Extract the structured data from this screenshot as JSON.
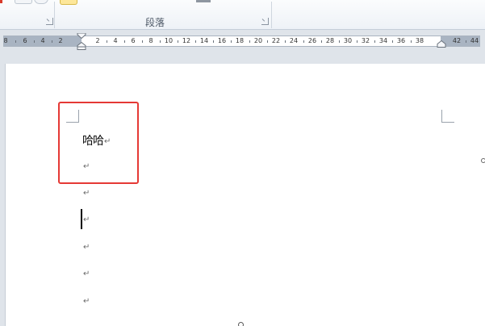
{
  "ribbon": {
    "group_label": "段落"
  },
  "ruler": {
    "labels": [
      "8",
      "6",
      "4",
      "2",
      "2",
      "4",
      "6",
      "8",
      "10",
      "12",
      "14",
      "16",
      "18",
      "20",
      "22",
      "24",
      "26",
      "28",
      "30",
      "32",
      "34",
      "36",
      "38",
      "42",
      "44"
    ]
  },
  "document": {
    "lines": [
      "哈哈",
      "",
      "",
      "",
      "",
      "",
      ""
    ],
    "paragraph_mark": "↵"
  },
  "highlight": {
    "color": "#e53935"
  }
}
